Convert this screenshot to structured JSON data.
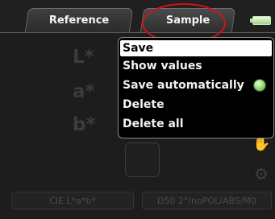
{
  "tabs": [
    {
      "label": "Reference",
      "active": false
    },
    {
      "label": "Sample",
      "active": true
    }
  ],
  "battery": {
    "icon": "battery-icon",
    "color": "#9fd284"
  },
  "measurement": {
    "L_label": "L*",
    "a_label": "a*",
    "b_label": "b*"
  },
  "context_menu": {
    "items": [
      {
        "label": "Save",
        "selected": true
      },
      {
        "label": "Show values",
        "selected": false
      },
      {
        "label": "Save automatically",
        "selected": false,
        "toggle": "on"
      },
      {
        "label": "Delete",
        "selected": false
      },
      {
        "label": "Delete all",
        "selected": false
      }
    ]
  },
  "status": {
    "color_space": "CIE L*a*b*",
    "conditions": "D50 2°/noPOL/ABS/M0"
  },
  "side_icons": [
    "hand-icon",
    "gear-icon"
  ],
  "colors": {
    "highlight_ring": "#d0131a",
    "toggle_on": "#9fdc7c",
    "menu_background": "#000000",
    "screen_background": "#1c1d1c"
  }
}
